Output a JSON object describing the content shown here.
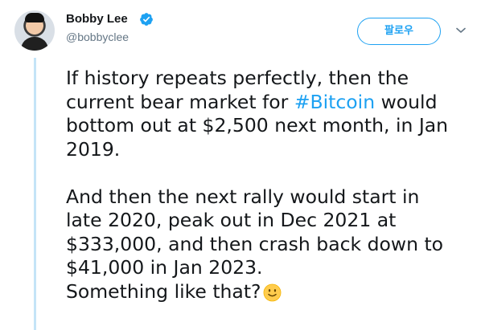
{
  "author": {
    "name": "Bobby Lee",
    "handle": "@bobbyclee"
  },
  "actions": {
    "follow_label": "팔로우"
  },
  "tweet": {
    "paragraph1_before": "If history repeats perfectly, then the\ncurrent bear market for ",
    "hashtag": "#Bitcoin",
    "paragraph1_after": " would\nbottom out at $2,500 next month, in Jan\n2019.",
    "paragraph2": "\n\nAnd then the next rally would start in\nlate 2020, peak out in Dec 2021 at\n$333,000, and then crash back down to\n$41,000 in Jan 2023.\nSomething like that?",
    "emoji": "slightly-smiling-face"
  },
  "colors": {
    "accent": "#1da1f2",
    "thread_line": "#c4e4f7",
    "text": "#14171a",
    "secondary_text": "#657786"
  }
}
